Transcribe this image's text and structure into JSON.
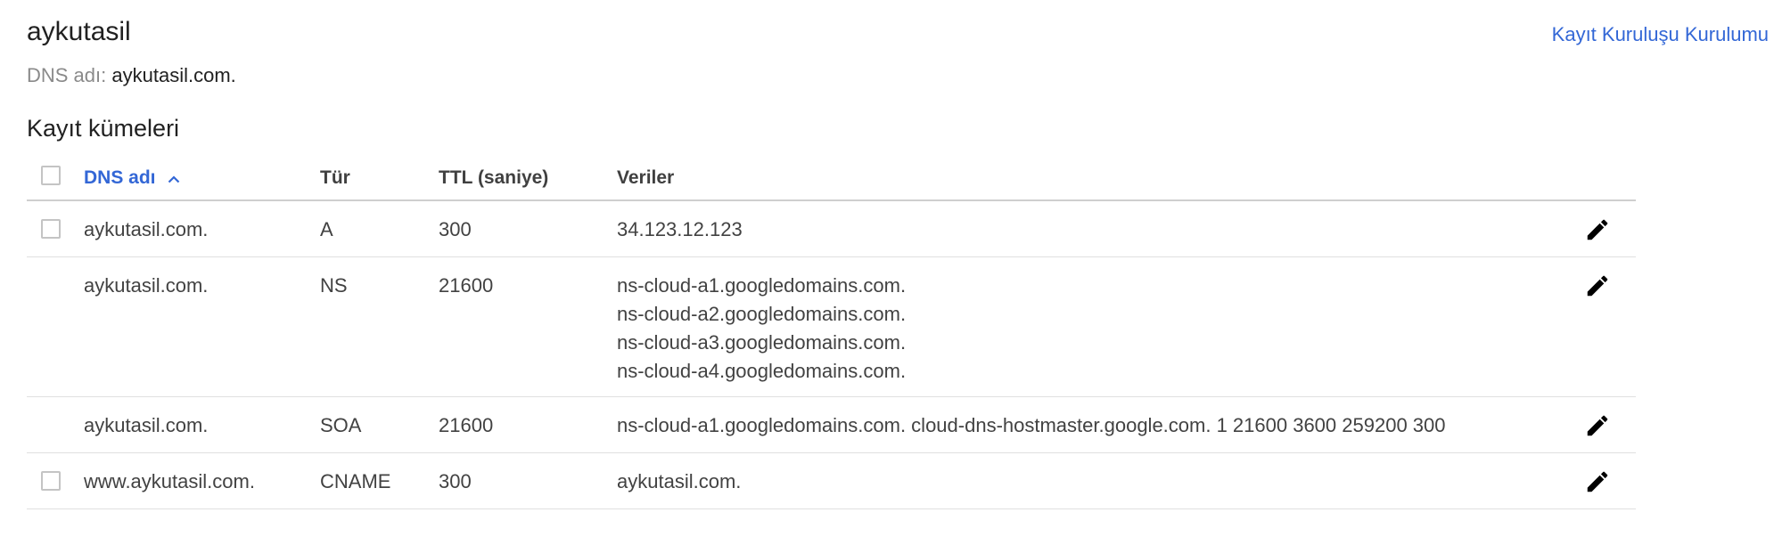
{
  "zone": {
    "title": "aykutasil",
    "dns_name_label": "DNS adı:",
    "dns_name_value": "aykutasil.com."
  },
  "header_link": "Kayıt Kuruluşu Kurulumu",
  "section_title": "Kayıt kümeleri",
  "columns": {
    "name": "DNS adı",
    "type": "Tür",
    "ttl": "TTL (saniye)",
    "data": "Veriler"
  },
  "sort": {
    "column": "name",
    "direction": "ascending"
  },
  "records": [
    {
      "name": "aykutasil.com.",
      "type": "A",
      "ttl": "300",
      "data": [
        "34.123.12.123"
      ],
      "selectable": true
    },
    {
      "name": "aykutasil.com.",
      "type": "NS",
      "ttl": "21600",
      "data": [
        "ns-cloud-a1.googledomains.com.",
        "ns-cloud-a2.googledomains.com.",
        "ns-cloud-a3.googledomains.com.",
        "ns-cloud-a4.googledomains.com."
      ],
      "selectable": false
    },
    {
      "name": "aykutasil.com.",
      "type": "SOA",
      "ttl": "21600",
      "data": [
        "ns-cloud-a1.googledomains.com. cloud-dns-hostmaster.google.com. 1 21600 3600 259200 300"
      ],
      "selectable": false
    },
    {
      "name": "www.aykutasil.com.",
      "type": "CNAME",
      "ttl": "300",
      "data": [
        "aykutasil.com."
      ],
      "selectable": true
    }
  ],
  "icons": {
    "edit": "pencil-icon",
    "sort": "chevron-up-icon"
  },
  "colors": {
    "link": "#3367d6",
    "muted": "#8a8a8a",
    "text": "#424242"
  }
}
